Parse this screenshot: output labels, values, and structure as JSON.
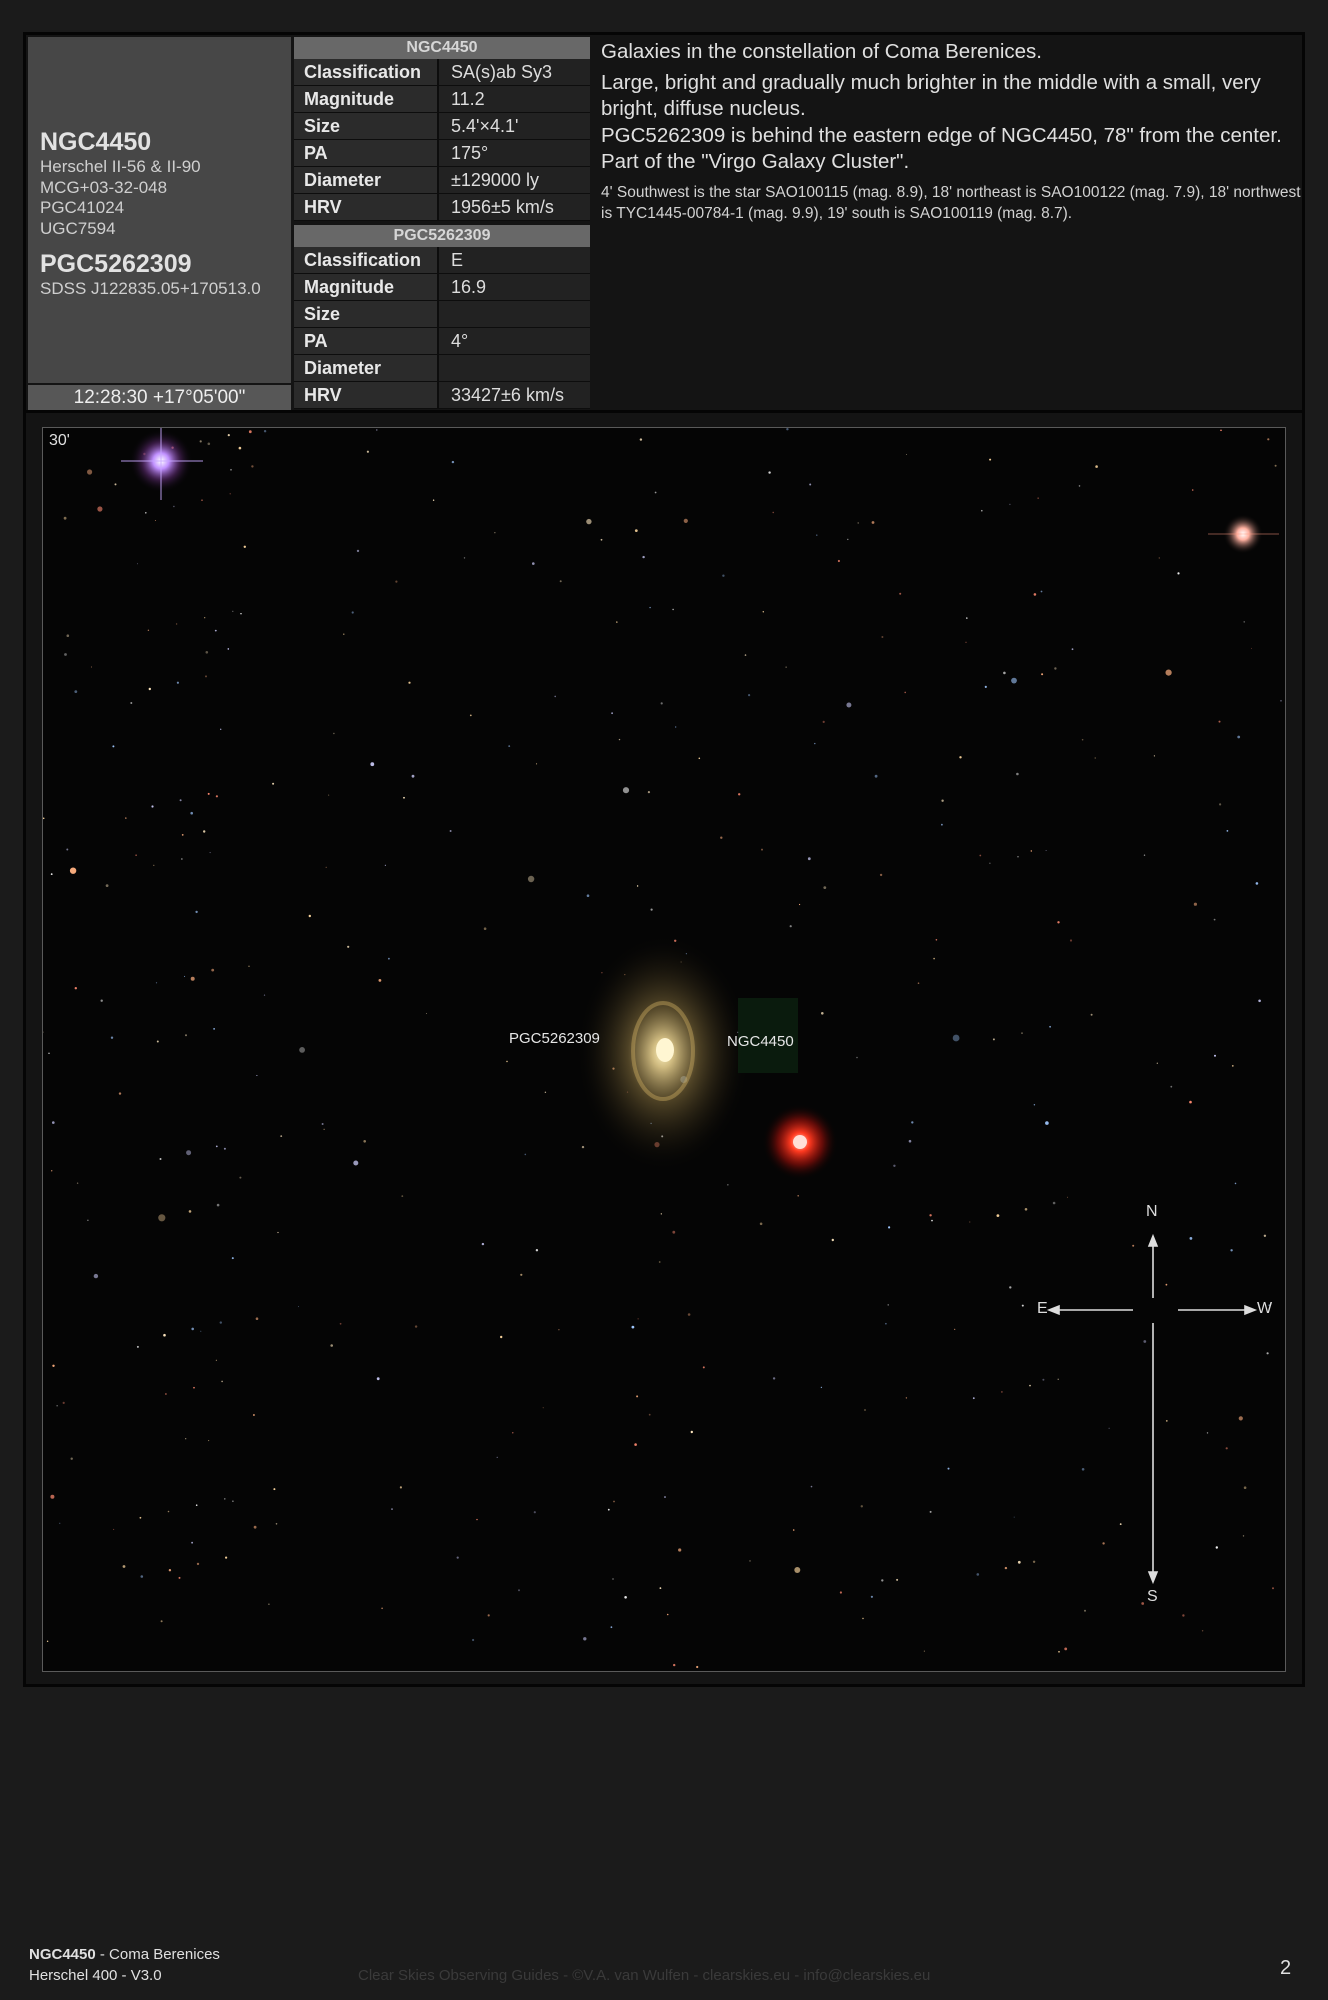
{
  "object": {
    "name": "NGC4450",
    "aliases": [
      "Herschel II-56 & II-90",
      "MCG+03-32-048",
      "PGC41024",
      "UGC7594"
    ],
    "secondary_name": "PGC5262309",
    "secondary_alias": "SDSS J122835.05+170513.0",
    "coordinates": "12:28:30 +17°05'00\""
  },
  "table1": {
    "header": "NGC4450",
    "rows": [
      {
        "key": "Classification",
        "value": "SA(s)ab Sy3"
      },
      {
        "key": "Magnitude",
        "value": "11.2"
      },
      {
        "key": "Size",
        "value": "5.4'×4.1'"
      },
      {
        "key": "PA",
        "value": "175°"
      },
      {
        "key": "Diameter",
        "value": "±129000 ly"
      },
      {
        "key": "HRV",
        "value": "1956±5 km/s"
      }
    ]
  },
  "table2": {
    "header": "PGC5262309",
    "rows": [
      {
        "key": "Classification",
        "value": "E"
      },
      {
        "key": "Magnitude",
        "value": "16.9"
      },
      {
        "key": "Size",
        "value": ""
      },
      {
        "key": "PA",
        "value": "4°"
      },
      {
        "key": "Diameter",
        "value": ""
      },
      {
        "key": "HRV",
        "value": "33427±6 km/s"
      }
    ]
  },
  "description": {
    "lines": [
      "Galaxies in the constellation of Coma Berenices.",
      "Large, bright and gradually much brighter in the middle with a small, very bright, diffuse nucleus.",
      "PGC5262309 is behind the eastern edge of NGC4450, 78\" from the center.",
      "Part of the \"Virgo Galaxy Cluster\"."
    ],
    "stars": "4' Southwest is the star SAO100115 (mag. 8.9), 18' northeast is SAO100122 (mag. 7.9), 18' northwest is TYC1445-00784-1 (mag. 9.9), 19' south is SAO100119 (mag. 8.7)."
  },
  "image": {
    "scale": "30'",
    "label_pgc": "PGC5262309",
    "label_ngc": "NGC4450",
    "compass": {
      "n": "N",
      "e": "E",
      "w": "W",
      "s": "S"
    }
  },
  "footer": {
    "title_bold": "NGC4450",
    "title_rest": " - Coma Berenices",
    "subtitle": "Herschel 400 - V3.0",
    "credit": "Clear Skies Observing Guides - ©V.A. van Wulfen - clearskies.eu - info@clearskies.eu",
    "page": "2"
  }
}
